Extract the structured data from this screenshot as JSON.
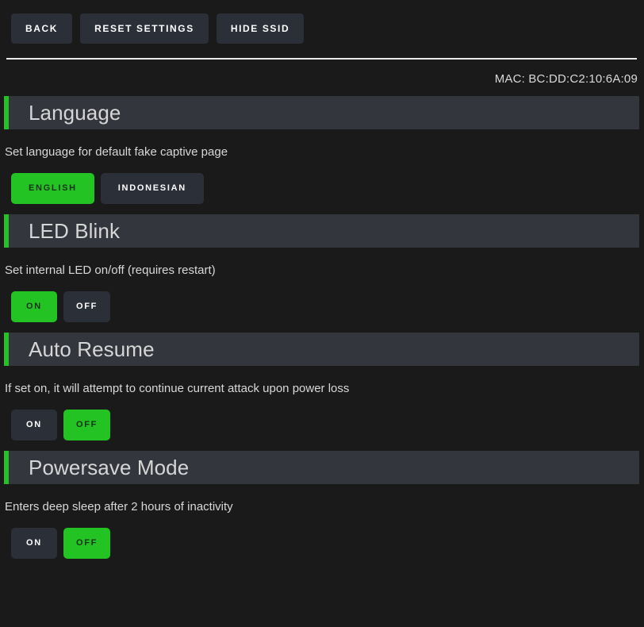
{
  "toolbar": {
    "buttons": [
      {
        "label": "BACK",
        "name": "back-button"
      },
      {
        "label": "RESET SETTINGS",
        "name": "reset-settings-button"
      },
      {
        "label": "HIDE SSID",
        "name": "hide-ssid-button"
      }
    ]
  },
  "device": {
    "mac_label": "MAC: BC:DD:C2:10:6A:09"
  },
  "colors": {
    "accent_green": "#22c322",
    "page_background": "#1a1a1a",
    "header_background": "#33363d",
    "button_inactive": "#2b2f38"
  },
  "sections": [
    {
      "title": "Language",
      "description": "Set language for default fake captive page",
      "options": [
        {
          "label": "ENGLISH",
          "active": true
        },
        {
          "label": "INDONESIAN",
          "active": false
        }
      ]
    },
    {
      "title": "LED Blink",
      "description": "Set internal LED on/off (requires restart)",
      "options": [
        {
          "label": "ON",
          "active": true
        },
        {
          "label": "OFF",
          "active": false
        }
      ]
    },
    {
      "title": "Auto Resume",
      "description": "If set on, it will attempt to continue current attack upon power loss",
      "options": [
        {
          "label": "ON",
          "active": false
        },
        {
          "label": "OFF",
          "active": true
        }
      ]
    },
    {
      "title": "Powersave Mode",
      "description": "Enters deep sleep after 2 hours of inactivity",
      "options": [
        {
          "label": "ON",
          "active": false
        },
        {
          "label": "OFF",
          "active": true
        }
      ]
    }
  ]
}
